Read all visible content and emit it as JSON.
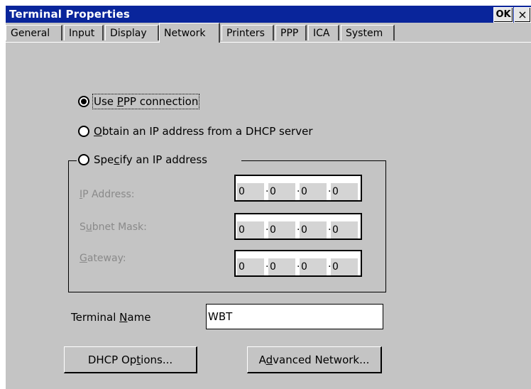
{
  "window": {
    "title": "Terminal Properties",
    "ok_label": "OK",
    "close_label": "×"
  },
  "tabs": [
    {
      "label": "General"
    },
    {
      "label": "Input"
    },
    {
      "label": "Display"
    },
    {
      "label": "Network",
      "active": true
    },
    {
      "label": "Printers"
    },
    {
      "label": "PPP"
    },
    {
      "label": "ICA"
    },
    {
      "label": "System"
    }
  ],
  "network": {
    "use_ppp": {
      "pre": "Use ",
      "ul": "P",
      "post": "PP connection",
      "checked": true
    },
    "dhcp": {
      "pre": "",
      "ul": "O",
      "post": "btain an IP address from a DHCP server",
      "checked": false
    },
    "specify": {
      "pre": "Spe",
      "ul": "c",
      "post": "ify an IP address",
      "checked": false
    },
    "ip_address": {
      "pre": "",
      "ul": "I",
      "post": "P Address:",
      "octets": [
        "0",
        "0",
        "0",
        "0"
      ]
    },
    "subnet_mask": {
      "pre": "S",
      "ul": "u",
      "post": "bnet Mask:",
      "octets": [
        "0",
        "0",
        "0",
        "0"
      ]
    },
    "gateway": {
      "pre": "",
      "ul": "G",
      "post": "ateway:",
      "octets": [
        "0",
        "0",
        "0",
        "0"
      ]
    },
    "terminal_name": {
      "pre": "Terminal ",
      "ul": "N",
      "post": "ame",
      "value": "WBT"
    },
    "dhcp_options": {
      "pre": "DHCP Op",
      "ul": "t",
      "post": "ions..."
    },
    "advanced_network": {
      "pre": "A",
      "ul": "d",
      "post": "vanced Network..."
    }
  }
}
